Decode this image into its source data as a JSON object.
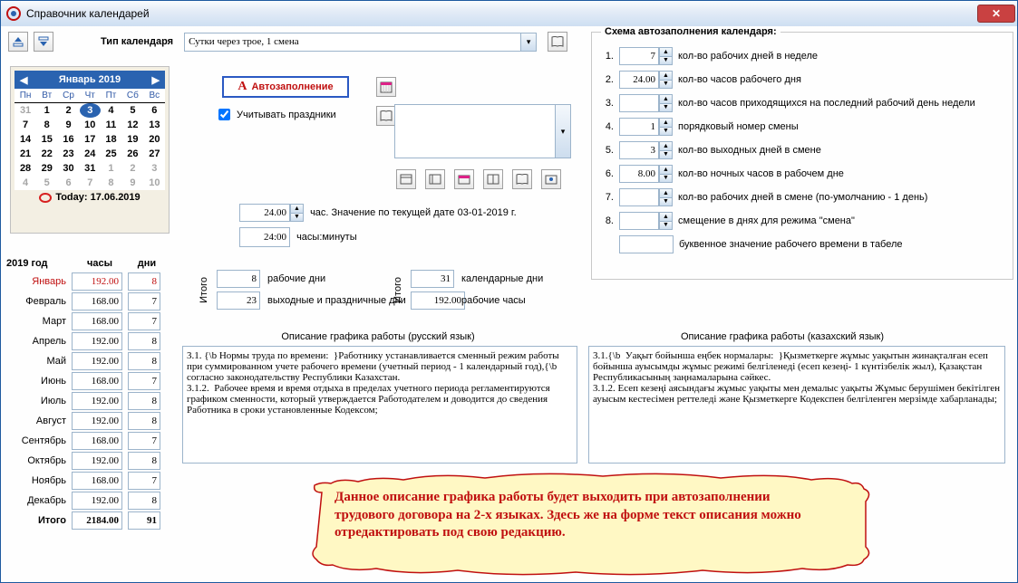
{
  "window_title": "Справочник календарей",
  "toolbar": {
    "type_label": "Тип календаря",
    "type_value": "Сутки через трое, 1 смена"
  },
  "scheme": {
    "legend": "Схема автозаполнения календаря:",
    "rows": [
      {
        "n": "1.",
        "v": "7",
        "lbl": "кол-во рабочих дней в неделе"
      },
      {
        "n": "2.",
        "v": "24.00",
        "lbl": "кол-во часов рабочего дня"
      },
      {
        "n": "3.",
        "v": "",
        "lbl": "кол-во часов приходящихся на последний рабочий день недели"
      },
      {
        "n": "4.",
        "v": "1",
        "lbl": "порядковый номер смены"
      },
      {
        "n": "5.",
        "v": "3",
        "lbl": "кол-во выходных дней в смене"
      },
      {
        "n": "6.",
        "v": "8.00",
        "lbl": "кол-во ночных часов в рабочем дне"
      },
      {
        "n": "7.",
        "v": "",
        "lbl": "кол-во рабочих дней в смене (по-умолчанию - 1 день)"
      },
      {
        "n": "8.",
        "v": "",
        "lbl": "смещение в днях для режима \"смена\""
      }
    ],
    "letter_lbl": "буквенное значение рабочего времени в табеле",
    "letter_val": ""
  },
  "calendar": {
    "month_title": "Январь 2019",
    "dow": [
      "Пн",
      "Вт",
      "Ср",
      "Чт",
      "Пт",
      "Сб",
      "Вс"
    ],
    "weeks": [
      [
        {
          "d": "31",
          "g": true
        },
        {
          "d": "1"
        },
        {
          "d": "2"
        },
        {
          "d": "3",
          "sel": true
        },
        {
          "d": "4"
        },
        {
          "d": "5"
        },
        {
          "d": "6"
        }
      ],
      [
        {
          "d": "7"
        },
        {
          "d": "8"
        },
        {
          "d": "9"
        },
        {
          "d": "10"
        },
        {
          "d": "11"
        },
        {
          "d": "12"
        },
        {
          "d": "13"
        }
      ],
      [
        {
          "d": "14"
        },
        {
          "d": "15"
        },
        {
          "d": "16"
        },
        {
          "d": "17"
        },
        {
          "d": "18"
        },
        {
          "d": "19"
        },
        {
          "d": "20"
        }
      ],
      [
        {
          "d": "21"
        },
        {
          "d": "22"
        },
        {
          "d": "23"
        },
        {
          "d": "24"
        },
        {
          "d": "25"
        },
        {
          "d": "26"
        },
        {
          "d": "27"
        }
      ],
      [
        {
          "d": "28"
        },
        {
          "d": "29"
        },
        {
          "d": "30"
        },
        {
          "d": "31"
        },
        {
          "d": "1",
          "g": true
        },
        {
          "d": "2",
          "g": true
        },
        {
          "d": "3",
          "g": true
        }
      ],
      [
        {
          "d": "4",
          "g": true
        },
        {
          "d": "5",
          "g": true
        },
        {
          "d": "6",
          "g": true
        },
        {
          "d": "7",
          "g": true
        },
        {
          "d": "8",
          "g": true
        },
        {
          "d": "9",
          "g": true
        },
        {
          "d": "10",
          "g": true
        }
      ]
    ],
    "today": "Today: 17.06.2019"
  },
  "autofill": "Автозаполнение",
  "chk_holidays": "Учитывать праздники",
  "hours_val": "24.00",
  "hours_lbl": "час. Значение по текущей дате 03-01-2019 г.",
  "hm_val": "24:00",
  "hm_lbl": "часы:минуты",
  "year_table": {
    "year": "2019 год",
    "h_hours": "часы",
    "h_days": "дни",
    "rows": [
      {
        "m": "Январь",
        "h": "192.00",
        "d": "8",
        "jan": true
      },
      {
        "m": "Февраль",
        "h": "168.00",
        "d": "7"
      },
      {
        "m": "Март",
        "h": "168.00",
        "d": "7"
      },
      {
        "m": "Апрель",
        "h": "192.00",
        "d": "8"
      },
      {
        "m": "Май",
        "h": "192.00",
        "d": "8"
      },
      {
        "m": "Июнь",
        "h": "168.00",
        "d": "7"
      },
      {
        "m": "Июль",
        "h": "192.00",
        "d": "8"
      },
      {
        "m": "Август",
        "h": "192.00",
        "d": "8"
      },
      {
        "m": "Сентябрь",
        "h": "168.00",
        "d": "7"
      },
      {
        "m": "Октябрь",
        "h": "192.00",
        "d": "8"
      },
      {
        "m": "Ноябрь",
        "h": "168.00",
        "d": "7"
      },
      {
        "m": "Декабрь",
        "h": "192.00",
        "d": "8"
      }
    ],
    "total": {
      "m": "Итого",
      "h": "2184.00",
      "d": "91"
    }
  },
  "itogo": {
    "label": "Итого",
    "work_days_v": "8",
    "work_days_l": "рабочие дни",
    "wk_days_v": "23",
    "wk_days_l": "выходные и праздничные дни",
    "cal_days_v": "31",
    "cal_days_l": "календарные дни",
    "work_h_v": "192.00",
    "work_h_l": "рабочие часы"
  },
  "desc": {
    "ru_title": "Описание графика работы (русский язык)",
    "kz_title": "Описание графика работы (казахский язык)",
    "ru_text": "3.1. {\\b Нормы труда по времени:  }Работнику устанавливается сменный режим работы при суммированном учете рабочего времени (учетный период - 1 календарный год),{\\b  согласно законодательству Республики Казахстан.\n3.1.2.  Рабочее время и время отдыха в пределах учетного периода регламентируются графиком сменности, который утверждается Работодателем и доводится до сведения Работника в сроки установленные Кодексом;",
    "kz_text": "3.1.{\\b  Уақыт бойынша еңбек нормалары:  }Қызметкерге жұмыс уақытын жинақталған есеп бойынша ауысымды жұмыс режимі белгіленеді (есеп кезеңі- 1 күнтізбелік жыл), Қазақстан Республикасының заңнамаларына сәйкес.\n3.1.2. Есеп кезеңі аясындағы жұмыс уақыты мен демалыс уақыты Жұмыс берушімен бекітілген ауысым кестесімен реттеледі және Қызметкерге Кодекспен белгіленген мерзімде хабарланады;"
  },
  "callout": "Данное описание графика работы будет выходить при автозаполнении трудового договора на 2-х языках. Здесь же на форме текст описания можно отредактировать под свою редакцию."
}
